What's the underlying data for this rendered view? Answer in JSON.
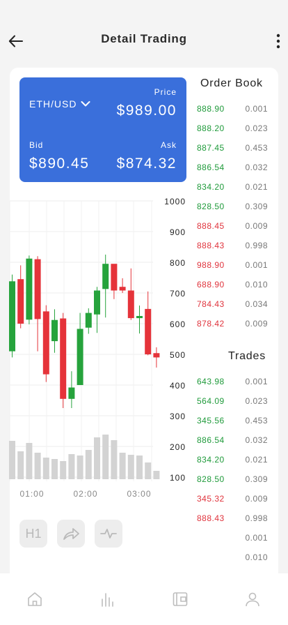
{
  "header": {
    "title": "Detail Trading",
    "back_icon": "arrow-left-icon",
    "more_icon": "more-vertical-icon"
  },
  "ticker": {
    "pair": "ETH/USD",
    "price_label": "Price",
    "price": "$989.00",
    "bid_label": "Bid",
    "bid": "$890.45",
    "ask_label": "Ask",
    "ask": "$874.32"
  },
  "chart_data": {
    "type": "candlestick",
    "y_ticks": [
      "1000",
      "900",
      "800",
      "700",
      "600",
      "500",
      "400",
      "300",
      "200",
      "100"
    ],
    "x_ticks": [
      "01:00",
      "02:00",
      "03:00"
    ],
    "ylim": [
      100,
      1000
    ],
    "colors": {
      "up": "#26a33c",
      "down": "#e5333a",
      "volume": "#d3d3d3"
    },
    "candles": [
      {
        "o": 510,
        "c": 738,
        "h": 760,
        "l": 490
      },
      {
        "o": 745,
        "c": 600,
        "h": 790,
        "l": 585
      },
      {
        "o": 613,
        "c": 812,
        "h": 822,
        "l": 598
      },
      {
        "o": 810,
        "c": 615,
        "h": 820,
        "l": 510
      },
      {
        "o": 640,
        "c": 435,
        "h": 660,
        "l": 410
      },
      {
        "o": 543,
        "c": 612,
        "h": 647,
        "l": 505
      },
      {
        "o": 617,
        "c": 355,
        "h": 635,
        "l": 325
      },
      {
        "o": 355,
        "c": 392,
        "h": 445,
        "l": 325
      },
      {
        "o": 400,
        "c": 583,
        "h": 635,
        "l": 400
      },
      {
        "o": 587,
        "c": 635,
        "h": 650,
        "l": 567
      },
      {
        "o": 630,
        "c": 708,
        "h": 720,
        "l": 570
      },
      {
        "o": 713,
        "c": 795,
        "h": 825,
        "l": 620
      },
      {
        "o": 795,
        "c": 708,
        "h": 788,
        "l": 680
      },
      {
        "o": 720,
        "c": 708,
        "h": 748,
        "l": 700
      },
      {
        "o": 708,
        "c": 618,
        "h": 780,
        "l": 612
      },
      {
        "o": 618,
        "c": 625,
        "h": 659,
        "l": 568
      },
      {
        "o": 648,
        "c": 500,
        "h": 705,
        "l": 497
      },
      {
        "o": 504,
        "c": 490,
        "h": 523,
        "l": 457
      }
    ],
    "volume": [
      55,
      40,
      52,
      38,
      31,
      29,
      26,
      36,
      34,
      42,
      60,
      64,
      56,
      38,
      35,
      34,
      24,
      12
    ]
  },
  "order_book": {
    "title": "Order Book",
    "rows": [
      {
        "price": "888.90",
        "qty": "0.001",
        "side": "buy"
      },
      {
        "price": "888.20",
        "qty": "0.023",
        "side": "buy"
      },
      {
        "price": "887.45",
        "qty": "0.453",
        "side": "buy"
      },
      {
        "price": "886.54",
        "qty": "0.032",
        "side": "buy"
      },
      {
        "price": "834.20",
        "qty": "0.021",
        "side": "buy"
      },
      {
        "price": "828.50",
        "qty": "0.309",
        "side": "buy"
      },
      {
        "price": "888.45",
        "qty": "0.009",
        "side": "sell"
      },
      {
        "price": "888.43",
        "qty": "0.998",
        "side": "sell"
      },
      {
        "price": "988.90",
        "qty": "0.001",
        "side": "sell"
      },
      {
        "price": "688.90",
        "qty": "0.010",
        "side": "sell"
      },
      {
        "price": "784.43",
        "qty": "0.034",
        "side": "sell"
      },
      {
        "price": "878.42",
        "qty": "0.009",
        "side": "sell"
      }
    ]
  },
  "trades": {
    "title": "Trades",
    "rows": [
      {
        "price": "643.98",
        "qty": "0.001",
        "side": "buy"
      },
      {
        "price": "564.09",
        "qty": "0.023",
        "side": "buy"
      },
      {
        "price": "345.56",
        "qty": "0.453",
        "side": "buy"
      },
      {
        "price": "886.54",
        "qty": "0.032",
        "side": "buy"
      },
      {
        "price": "834.20",
        "qty": "0.021",
        "side": "buy"
      },
      {
        "price": "828.50",
        "qty": "0.309",
        "side": "buy"
      },
      {
        "price": "345.32",
        "qty": "0.009",
        "side": "sell"
      },
      {
        "price": "888.43",
        "qty": "0.998",
        "side": "sell"
      },
      {
        "price": "",
        "qty": "0.001",
        "side": "none"
      },
      {
        "price": "",
        "qty": "0.010",
        "side": "none"
      }
    ]
  },
  "tools": [
    {
      "label": "H1",
      "icon": "timeframe-icon"
    },
    {
      "label": "",
      "icon": "share-icon"
    },
    {
      "label": "",
      "icon": "pulse-icon"
    }
  ],
  "nav": [
    {
      "icon": "home-icon"
    },
    {
      "icon": "chart-icon"
    },
    {
      "icon": "wallet-icon"
    },
    {
      "icon": "profile-icon"
    }
  ]
}
